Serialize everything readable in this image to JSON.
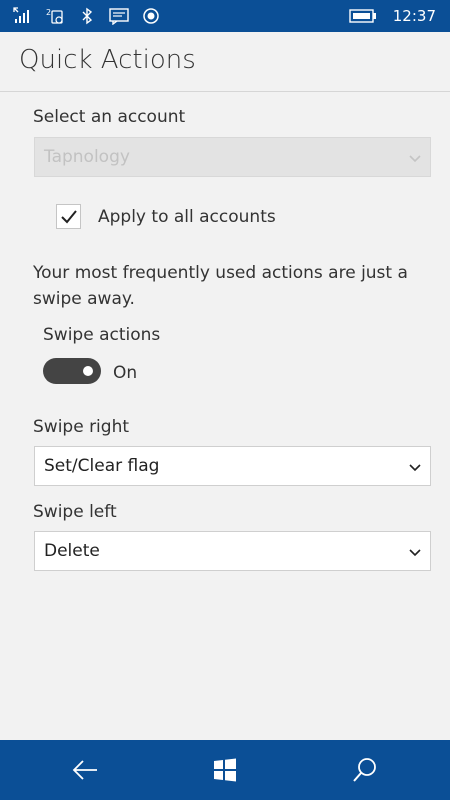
{
  "status_bar": {
    "time": "12:37",
    "icons": [
      "signal-icon",
      "sim-icon",
      "bluetooth-icon",
      "message-icon",
      "location-icon",
      "battery-icon"
    ]
  },
  "header": {
    "title": "Quick Actions"
  },
  "account": {
    "label": "Select an account",
    "selected": "Tapnology",
    "apply_all_label": "Apply to all accounts",
    "apply_all_checked": true
  },
  "swipe": {
    "description": "Your most frequently used actions are just a swipe away.",
    "actions_label": "Swipe actions",
    "toggle_state": "On",
    "right_label": "Swipe right",
    "right_value": "Set/Clear flag",
    "left_label": "Swipe left",
    "left_value": "Delete"
  },
  "nav": {
    "buttons": [
      "back-icon",
      "windows-icon",
      "search-icon"
    ]
  },
  "colors": {
    "accent": "#0b4f96",
    "background": "#f2f2f2",
    "toggle_on": "#444444"
  }
}
